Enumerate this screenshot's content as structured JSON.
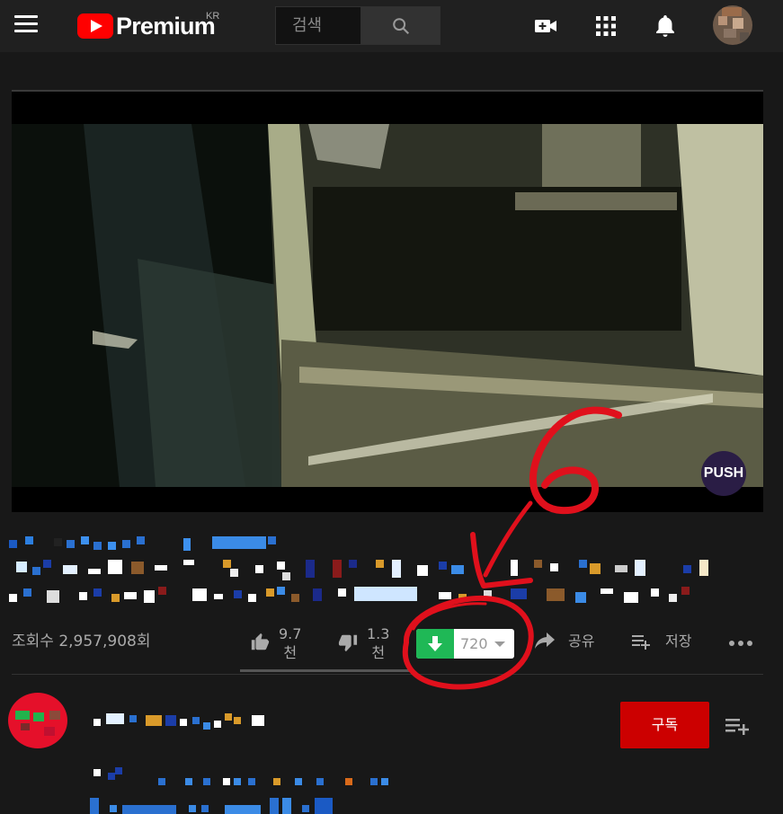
{
  "header": {
    "logo_text": "Premium",
    "logo_region": "KR",
    "search_placeholder": "검색"
  },
  "video": {
    "watermark": "PUSH"
  },
  "meta": {
    "views": "조회수 2,957,908회",
    "like_count": "9.7",
    "like_unit": "천",
    "dislike_count": "1.3",
    "dislike_unit": "천",
    "download_quality": "720",
    "share_label": "공유",
    "save_label": "저장"
  },
  "annotation": {
    "text": "6",
    "color": "#e0101c"
  },
  "channel": {
    "subscribe_label": "구독"
  },
  "colors": {
    "background": "#181818",
    "topbar": "#202020",
    "brand_red": "#ff0000",
    "subscribe_red": "#cc0000",
    "download_green": "#1fb856"
  }
}
